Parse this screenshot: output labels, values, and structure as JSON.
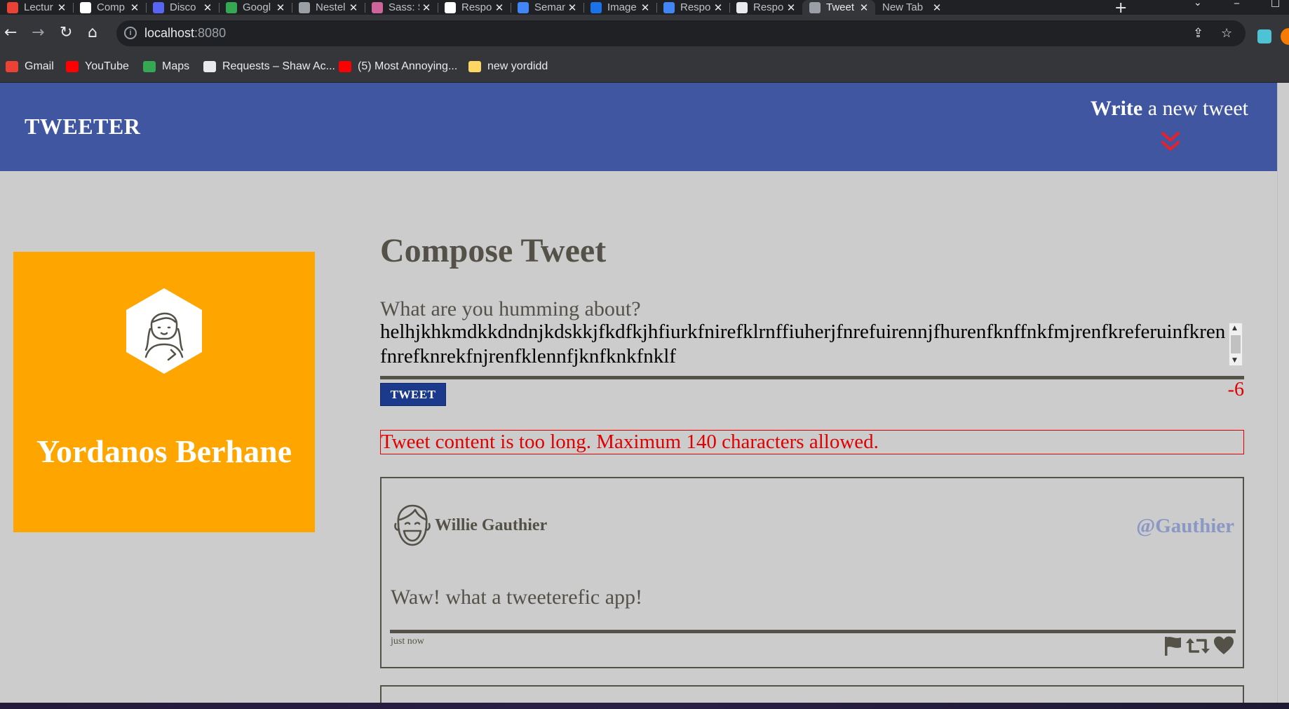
{
  "browser": {
    "tabs": [
      {
        "title": "Lectur",
        "color": "#ea4335"
      },
      {
        "title": "Comp",
        "color": "#ffffff"
      },
      {
        "title": "Disco",
        "color": "#5865f2"
      },
      {
        "title": "Googl",
        "color": "#34a853"
      },
      {
        "title": "Nestel",
        "color": "#9aa0a6"
      },
      {
        "title": "Sass: S",
        "color": "#cf649a"
      },
      {
        "title": "Respo",
        "color": "#ffffff"
      },
      {
        "title": "Seman",
        "color": "#4285f4"
      },
      {
        "title": "Image",
        "color": "#1a73e8"
      },
      {
        "title": "Respo",
        "color": "#4285f4"
      },
      {
        "title": "Respo",
        "color": "#e8eaed"
      },
      {
        "title": "Tweet",
        "color": "#9aa0a6"
      },
      {
        "title": "New Tab",
        "color": ""
      }
    ],
    "active_tab_index": 11,
    "url_host": "localhost",
    "url_port": ":8080",
    "bookmarks": [
      {
        "label": "Gmail",
        "color": "#ea4335"
      },
      {
        "label": "YouTube",
        "color": "#ff0000"
      },
      {
        "label": "Maps",
        "color": "#34a853"
      },
      {
        "label": "Requests – Shaw Ac...",
        "color": "#e8eaed"
      },
      {
        "label": "(5) Most Annoying...",
        "color": "#ff0000"
      },
      {
        "label": "new yordidd",
        "color": "#fdd663"
      }
    ]
  },
  "nav": {
    "brand": "TWEETER",
    "write_bold": "Write",
    "write_rest": " a new tweet"
  },
  "profile": {
    "name": "Yordanos Berhane"
  },
  "compose": {
    "title": "Compose Tweet",
    "label": "What are you humming about?",
    "text": "helhjkhkmdkkdndnjkdskkjfkdfkjhfiurkfnirefklrnffiuherjfnrefuirennjfhurenfknffnkfmjrenfkreferuinfkrenfnrefknrekfnjrenfklennfjknfknkfnklf",
    "button": "TWEET",
    "counter": "-6",
    "error": "Tweet content is too long. Maximum 140 characters allowed."
  },
  "tweets": [
    {
      "name": "Willie Gauthier",
      "handle": "@Gauthier",
      "body": "Waw! what a tweeterefic app!",
      "time": "just now"
    }
  ],
  "colors": {
    "nav_bg": "#4056a1",
    "page_bg": "#cccccc",
    "profile_bg": "#ffa500",
    "text": "#545149",
    "error": "#e00000",
    "handle": "#8a98c4",
    "button_bg": "#1b3a8c"
  }
}
